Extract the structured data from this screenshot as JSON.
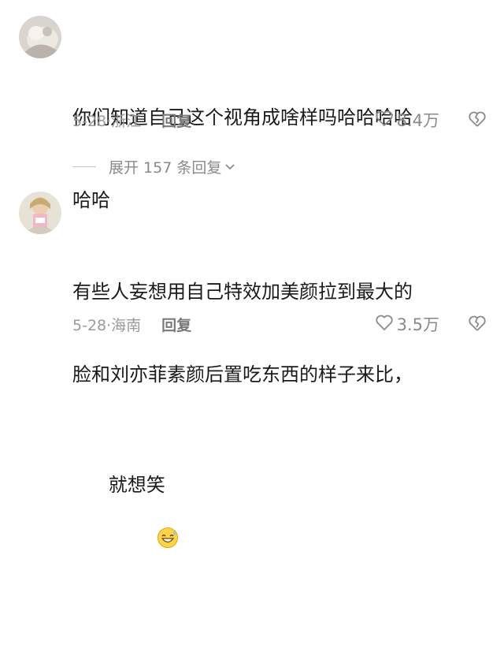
{
  "comments": [
    {
      "line1": "你们知道自己这个视角成啥样吗哈哈哈哈",
      "line2": "哈哈",
      "date": "5-28·浙江",
      "reply": "回复",
      "likes": "8.4万"
    },
    {
      "line1": "有些人妄想用自己特效加美颜拉到最大的",
      "line2": "脸和刘亦菲素颜后置吃东西的样子来比，",
      "line3": "就想笑",
      "date": "5-28·海南",
      "reply": "回复",
      "likes": "3.5万"
    }
  ],
  "expand": {
    "label": "展开 157 条回复"
  },
  "icons": {
    "like": "heart-outline-icon",
    "dislike": "broken-heart-icon",
    "expand": "chevron-down-icon",
    "emoji": "grinning-sweat-emoji"
  },
  "colors": {
    "text": "#1a1a1a",
    "meta": "#9b9b9b",
    "background": "#ffffff"
  }
}
